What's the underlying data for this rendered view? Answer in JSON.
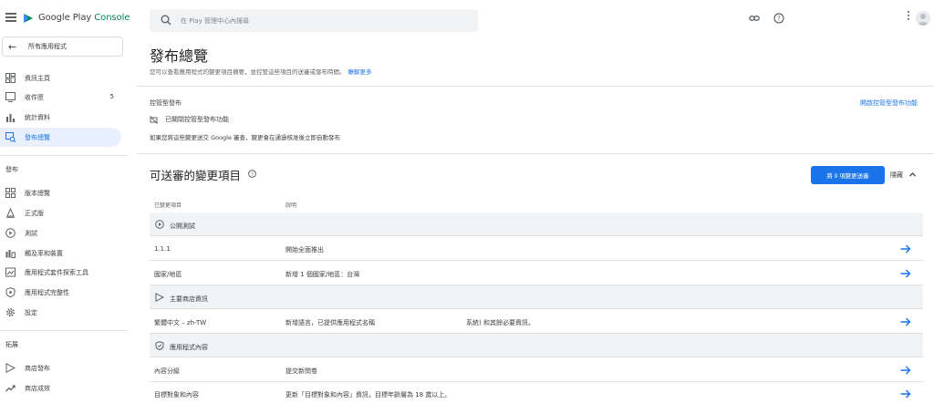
{
  "app": {
    "brand_google": "Google Play",
    "brand_console": "Console"
  },
  "sidebar": {
    "back_label": "所有應用程式",
    "items": [
      {
        "label": "資訊主頁",
        "icon": "dashboard-icon"
      },
      {
        "label": "收件匣",
        "icon": "inbox-icon",
        "count": "5"
      },
      {
        "label": "統計資料",
        "icon": "bar-chart-icon"
      },
      {
        "label": "發布總覽",
        "icon": "publishing-overview-icon",
        "active": true
      }
    ],
    "section_release": "發布",
    "release_items": [
      {
        "label": "版本總覽",
        "icon": "grid-icon"
      },
      {
        "label": "正式版",
        "icon": "bell-icon"
      },
      {
        "label": "測試",
        "icon": "test-icon"
      },
      {
        "label": "觸及率和裝置",
        "icon": "reach-icon"
      },
      {
        "label": "應用程式套件探索工具",
        "icon": "bundle-icon"
      },
      {
        "label": "應用程式完整性",
        "icon": "shield-icon"
      },
      {
        "label": "設定",
        "icon": "gear-icon"
      }
    ],
    "section_grow": "拓展",
    "grow_items": [
      {
        "label": "商店發布",
        "icon": "store-icon"
      },
      {
        "label": "商店成效",
        "icon": "trend-icon"
      }
    ]
  },
  "search": {
    "placeholder": "在 Play 管理中心內搜尋"
  },
  "page": {
    "title": "發布總覽",
    "subtitle": "您可以查看應用程式的變更項目摘要，並控管這些項目的送審或發布時間。",
    "learn_more": "瞭解更多"
  },
  "managed": {
    "title": "控管型發布",
    "link": "開啟控管型發布功能",
    "status": "已關閉控管型發布功能",
    "note": "如果您將這些變更送交 Google 審查，變更會在通過核准後立即自動發布"
  },
  "review": {
    "title": "可送審的變更項目",
    "send_button": "將 9 項變更送審",
    "collapse": "隱藏",
    "col_changed": "已變更項目",
    "col_desc": "說明"
  },
  "groups": [
    {
      "label": "公開測試",
      "icon": "public-test-icon"
    },
    {
      "label": "主要商店資訊",
      "icon": "play-store-icon"
    },
    {
      "label": "應用程式內容",
      "icon": "app-content-shield-icon"
    }
  ],
  "rows": [
    {
      "item": "1.1.1",
      "desc": "開始全面推出",
      "extra": ""
    },
    {
      "item": "國家/地區",
      "desc": "新增 1 個國家/地區：台灣",
      "extra": ""
    },
    {
      "item": "繁體中文 – zh-TW",
      "desc": "新增語言，已提供應用程式名稱",
      "extra": "系統) 和其餘必要資訊。"
    },
    {
      "item": "內容分級",
      "desc": "提交新問卷",
      "extra": ""
    },
    {
      "item": "目標對象和內容",
      "desc": "更新「目標對象和內容」資訊，目標年齡層為 18 歲以上。",
      "extra": ""
    }
  ]
}
